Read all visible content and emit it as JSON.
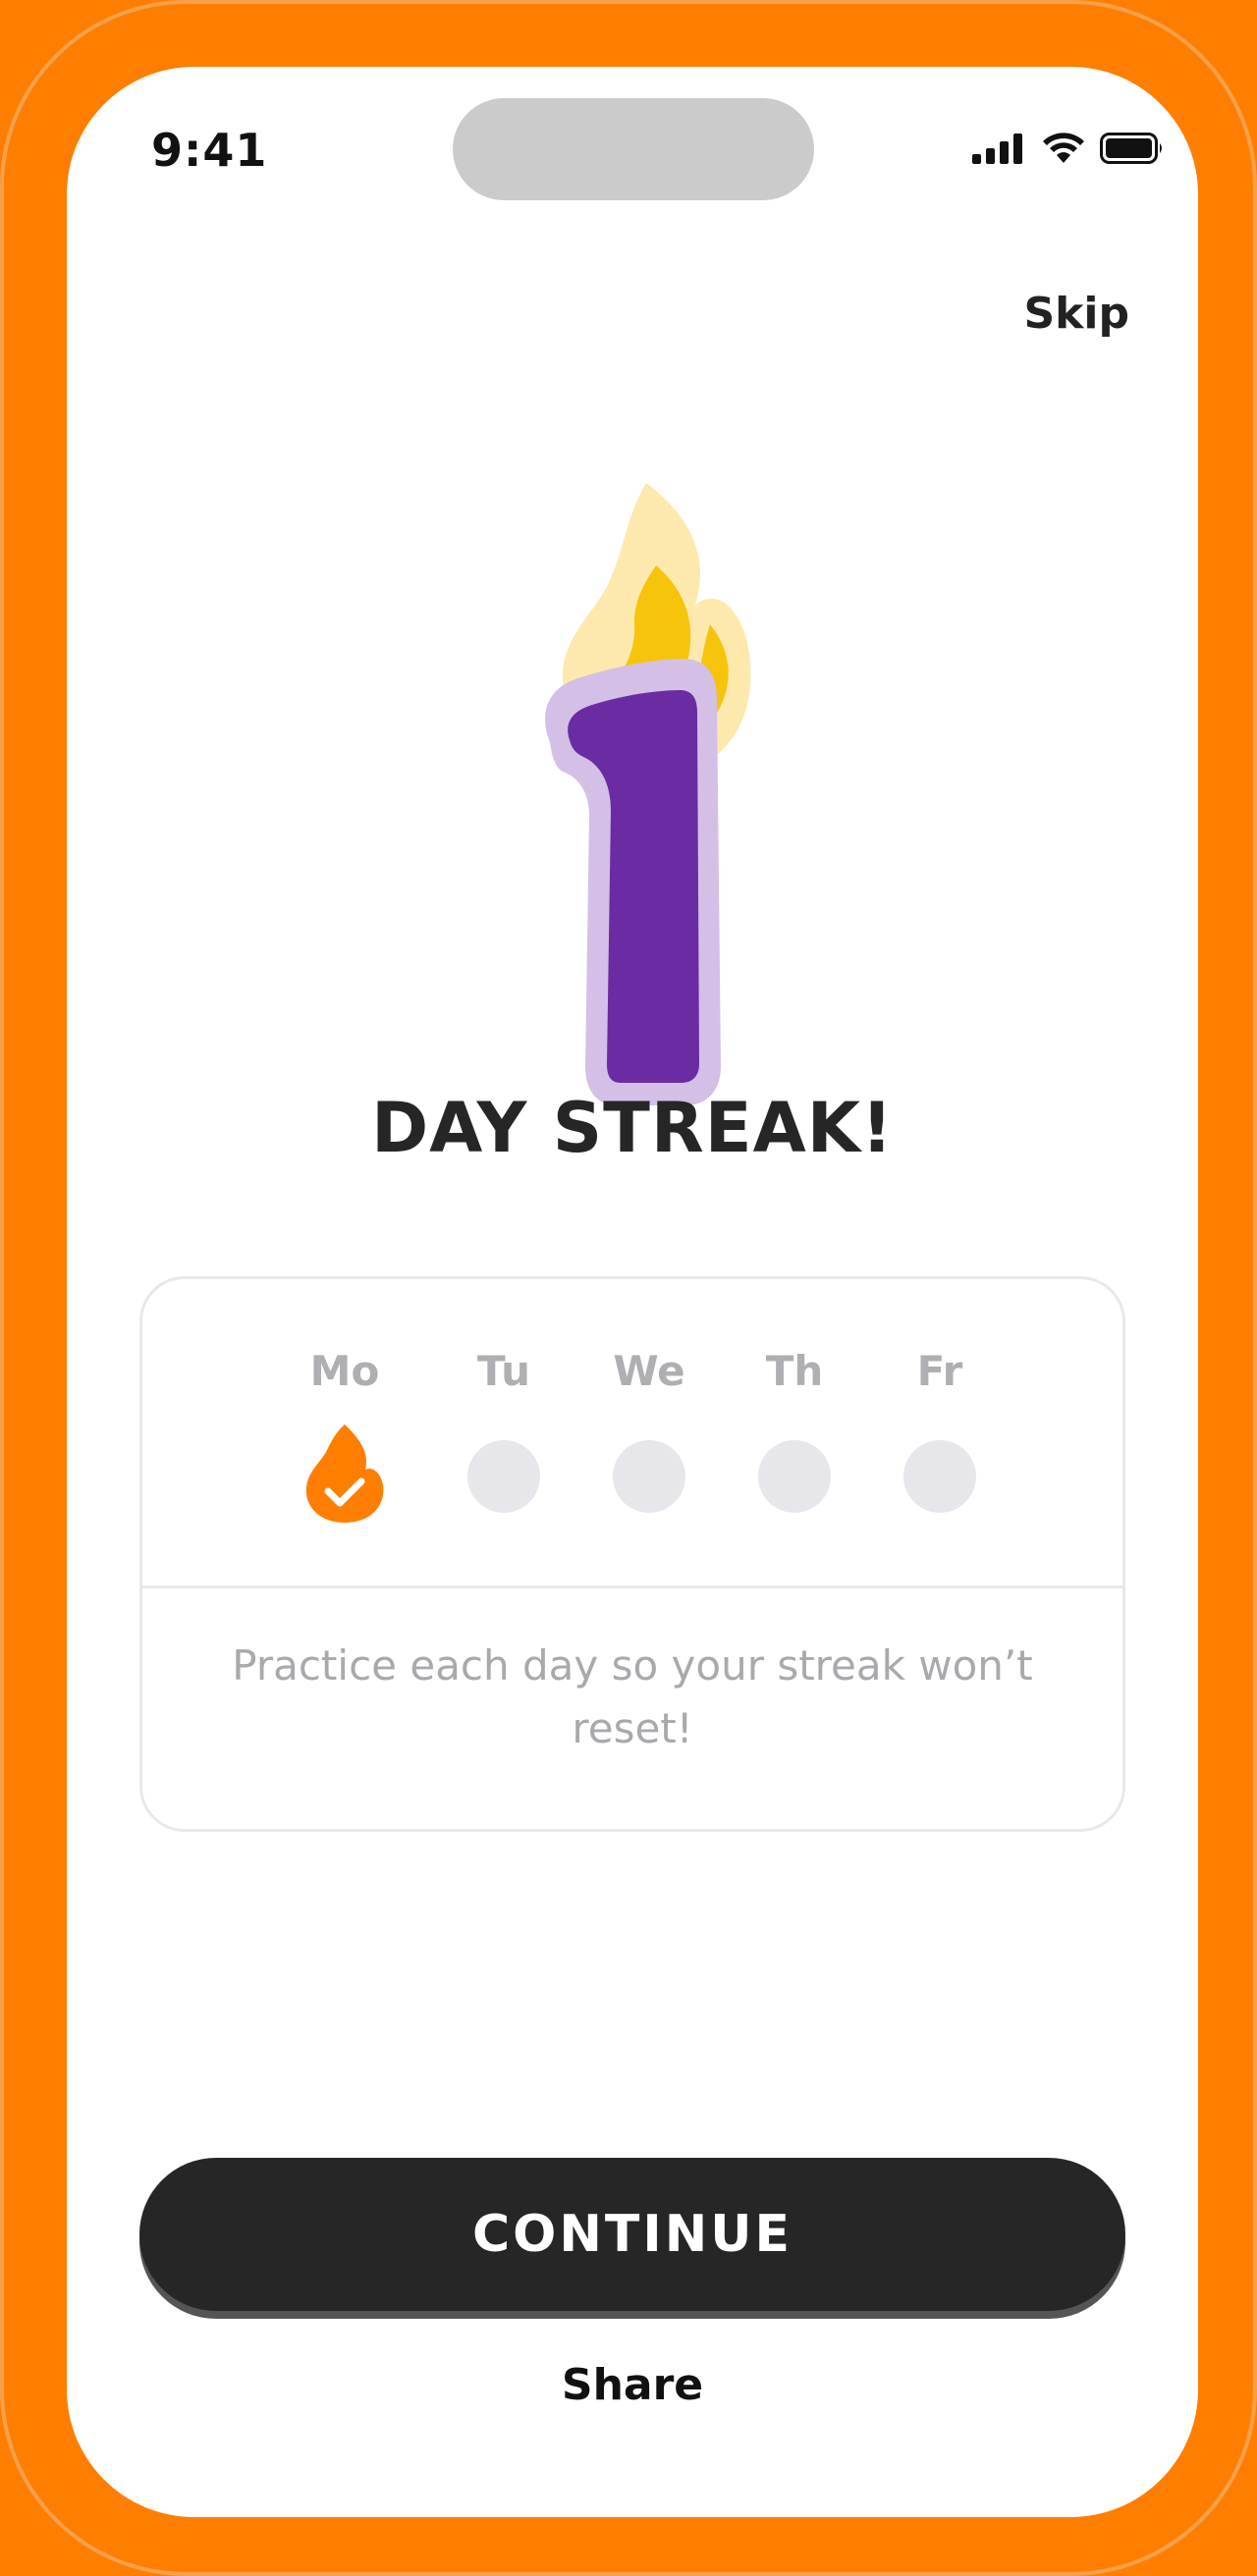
{
  "status_bar": {
    "time": "9:41",
    "icons": [
      "cellular-signal-icon",
      "wifi-icon",
      "battery-icon"
    ]
  },
  "header": {
    "skip_label": "Skip"
  },
  "hero": {
    "streak_count": "1",
    "icon": "flame-icon",
    "title": "DAY STREAK!"
  },
  "week": {
    "days": [
      {
        "label": "Mo",
        "completed": true
      },
      {
        "label": "Tu",
        "completed": false
      },
      {
        "label": "We",
        "completed": false
      },
      {
        "label": "Th",
        "completed": false
      },
      {
        "label": "Fr",
        "completed": false
      }
    ],
    "message": "Practice each day so your streak won’t reset!"
  },
  "actions": {
    "continue_label": "CONTINUE",
    "share_label": "Share"
  },
  "colors": {
    "brand_orange": "#FF7E00",
    "streak_purple": "#6A2BA3",
    "streak_purple_light": "#D4BFE6",
    "flame_yellow": "#F7C40C",
    "flame_yellow_light": "#FDE9AE",
    "button_dark": "#262626"
  }
}
